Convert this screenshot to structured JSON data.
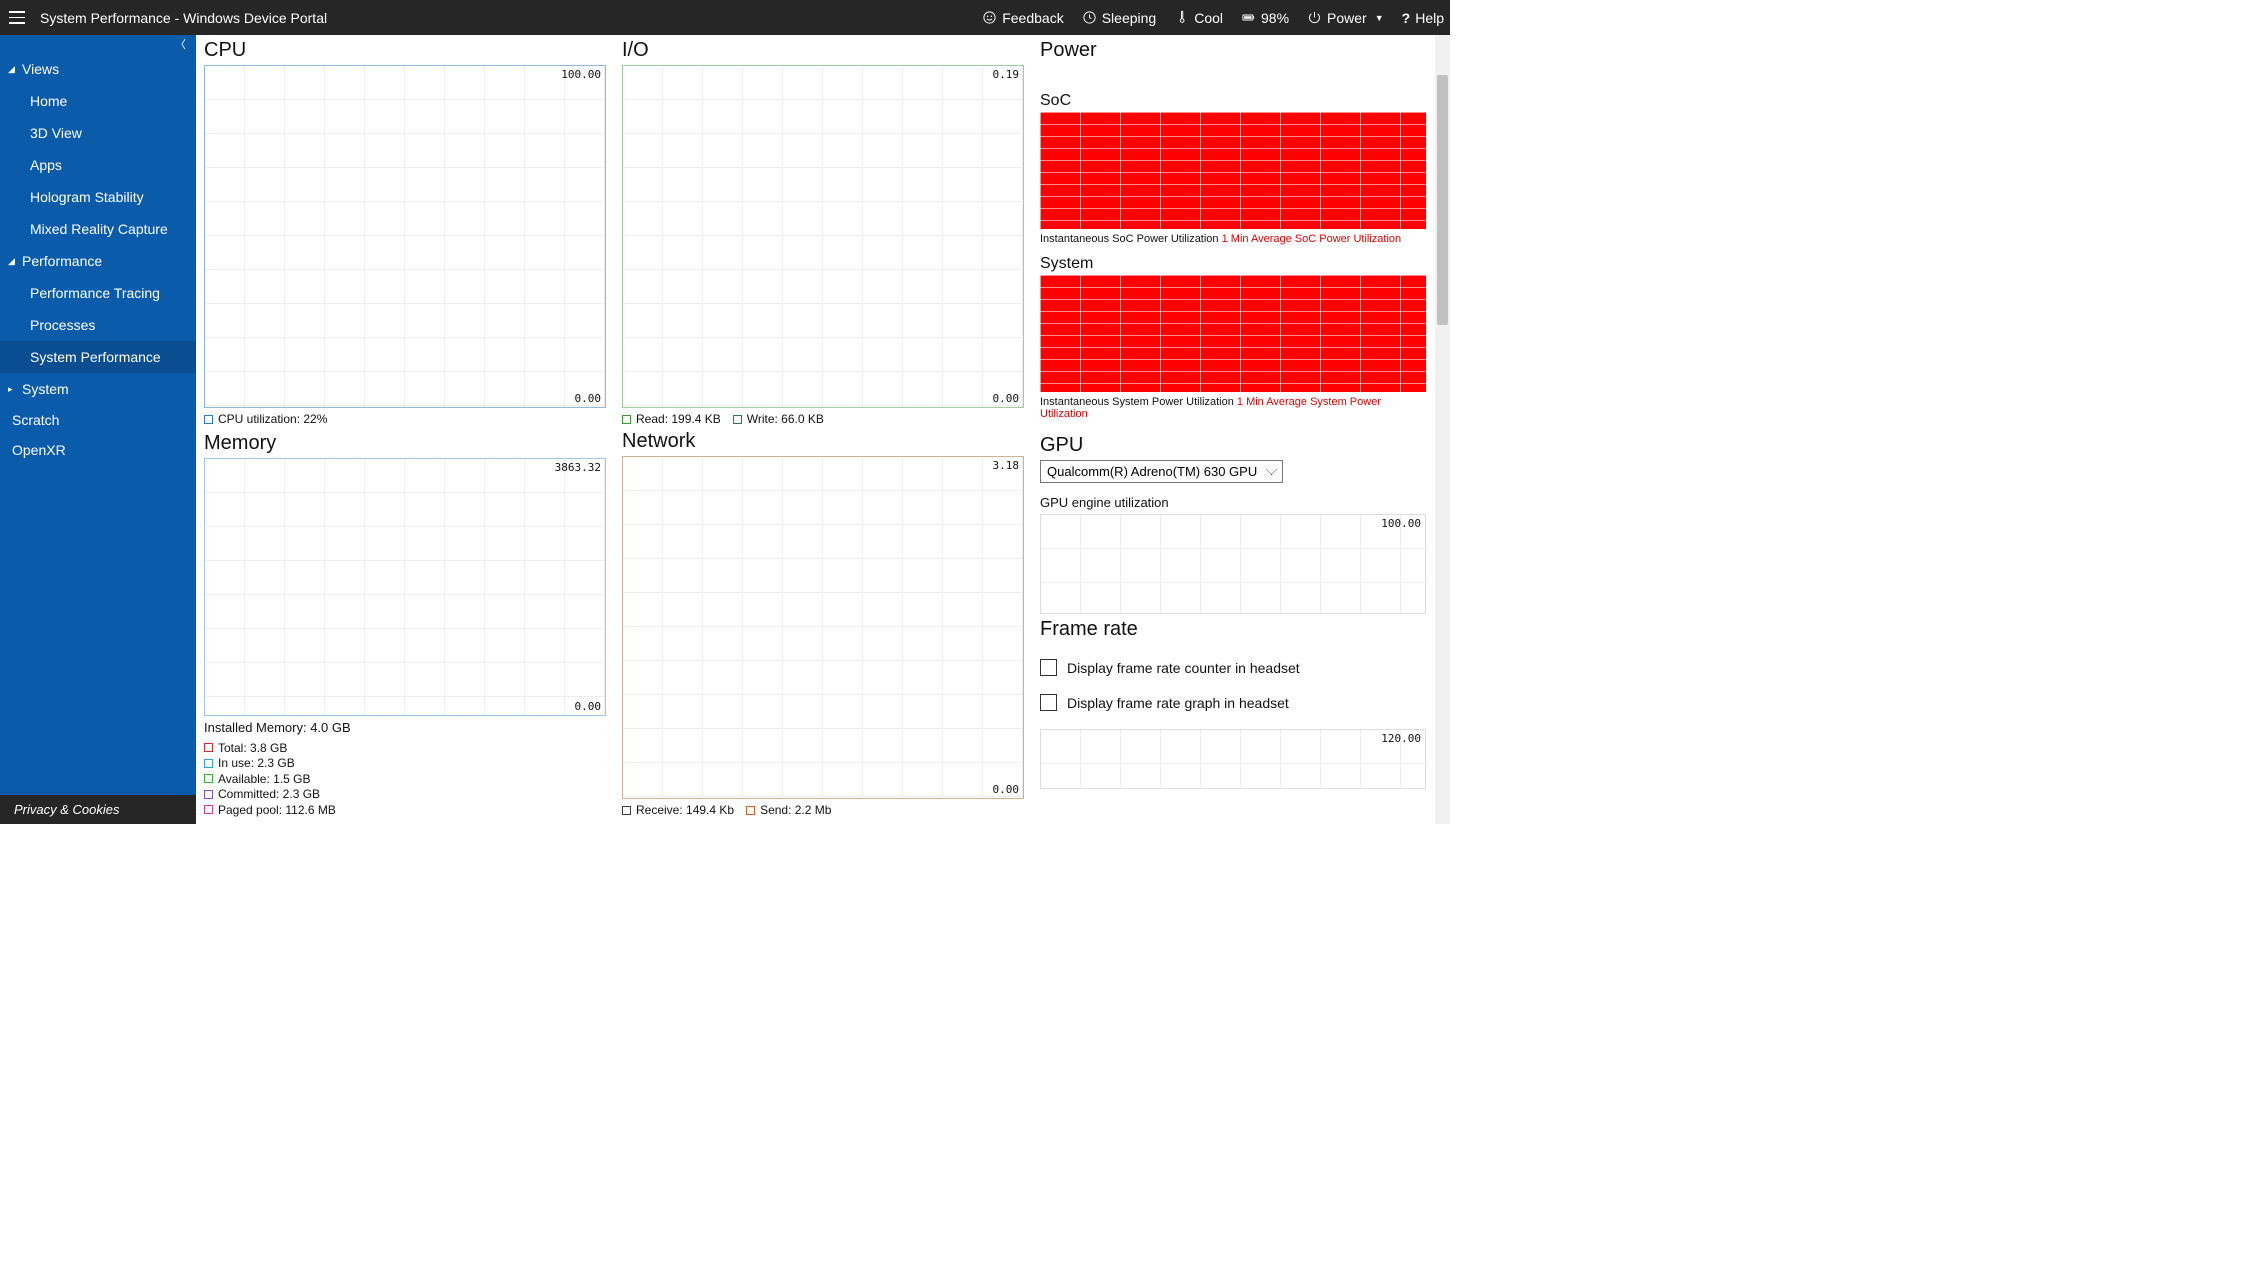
{
  "header": {
    "title": "System Performance - Windows Device Portal",
    "status": {
      "feedback": "Feedback",
      "sleeping": "Sleeping",
      "cool": "Cool",
      "battery": "98%",
      "power": "Power",
      "help": "Help"
    }
  },
  "sidebar": {
    "groups": [
      {
        "label": "Views",
        "expanded": true,
        "items": [
          "Home",
          "3D View",
          "Apps",
          "Hologram Stability",
          "Mixed Reality Capture"
        ]
      },
      {
        "label": "Performance",
        "expanded": true,
        "items": [
          "Performance Tracing",
          "Processes",
          "System Performance"
        ],
        "active_index": 2
      },
      {
        "label": "System",
        "expanded": false,
        "items": []
      }
    ],
    "flat": [
      "Scratch",
      "OpenXR"
    ],
    "footer": "Privacy & Cookies"
  },
  "panels": {
    "cpu": {
      "title": "CPU",
      "ymax": "100.00",
      "ymin": "0.00",
      "legend": "CPU utilization: 22%",
      "legend_color": "#2b7cd3"
    },
    "io": {
      "title": "I/O",
      "ymax": "0.19",
      "ymin": "0.00",
      "read_label": "Read: 199.4 KB",
      "write_label": "Write: 66.0 KB",
      "read_color": "#3a9a3a",
      "write_color": "#27736f"
    },
    "memory": {
      "title": "Memory",
      "ymax": "3863.32",
      "ymin": "0.00",
      "installed": "Installed Memory: 4.0 GB",
      "legend": [
        {
          "label": "Total: 3.8 GB",
          "color": "#d9232e"
        },
        {
          "label": "In use: 2.3 GB",
          "color": "#2aa7d6"
        },
        {
          "label": "Available: 1.5 GB",
          "color": "#2fb52f"
        },
        {
          "label": "Committed: 2.3 GB",
          "color": "#7b4fd6"
        },
        {
          "label": "Paged pool: 112.6 MB",
          "color": "#e23a8f"
        }
      ]
    },
    "network": {
      "title": "Network",
      "ymax": "3.18",
      "ymin": "0.00",
      "recv_label": "Receive: 149.4 Kb",
      "send_label": "Send: 2.2 Mb",
      "recv_color": "#3a3a3a",
      "send_color": "#d85a2a"
    },
    "power": {
      "title": "Power",
      "soc": {
        "title": "SoC",
        "inst": "Instantaneous SoC Power Utilization",
        "avg": "1 Min Average SoC Power Utilization"
      },
      "system": {
        "title": "System",
        "inst": "Instantaneous System Power Utilization",
        "avg": "1 Min Average System Power Utilization"
      }
    },
    "gpu": {
      "title": "GPU",
      "selected": "Qualcomm(R) Adreno(TM) 630 GPU",
      "engine_label": "GPU engine utilization",
      "ymax": "100.00"
    },
    "framerate": {
      "title": "Frame rate",
      "check1": "Display frame rate counter in headset",
      "check2": "Display frame rate graph in headset",
      "ymax": "120.00"
    }
  },
  "chart_data": [
    {
      "type": "line",
      "title": "CPU utilization",
      "ylim": [
        0,
        100
      ],
      "series": [
        {
          "name": "CPU utilization",
          "current": 22,
          "values": []
        }
      ]
    },
    {
      "type": "line",
      "title": "I/O",
      "ylim": [
        0,
        0.19
      ],
      "series": [
        {
          "name": "Read",
          "current_kb": 199.4,
          "values": []
        },
        {
          "name": "Write",
          "current_kb": 66.0,
          "values": []
        }
      ]
    },
    {
      "type": "line",
      "title": "Memory",
      "ylim": [
        0,
        3863.32
      ],
      "series": [
        {
          "name": "Total",
          "current_gb": 3.8
        },
        {
          "name": "In use",
          "current_gb": 2.3
        },
        {
          "name": "Available",
          "current_gb": 1.5
        },
        {
          "name": "Committed",
          "current_gb": 2.3
        },
        {
          "name": "Paged pool",
          "current_mb": 112.6
        }
      ],
      "installed_gb": 4.0
    },
    {
      "type": "line",
      "title": "Network",
      "ylim": [
        0,
        3.18
      ],
      "series": [
        {
          "name": "Receive",
          "current_kb": 149.4
        },
        {
          "name": "Send",
          "current_mb": 2.2
        }
      ]
    },
    {
      "type": "area",
      "title": "SoC Power Utilization",
      "ylim": [
        0,
        100
      ],
      "series": [
        {
          "name": "Instantaneous",
          "values_pct_fill": 100
        },
        {
          "name": "1 Min Average",
          "values_pct_fill": 100
        }
      ]
    },
    {
      "type": "area",
      "title": "System Power Utilization",
      "ylim": [
        0,
        100
      ],
      "series": [
        {
          "name": "Instantaneous",
          "values_pct_fill": 100
        },
        {
          "name": "1 Min Average",
          "values_pct_fill": 100
        }
      ]
    },
    {
      "type": "line",
      "title": "GPU engine utilization",
      "ylim": [
        0,
        100
      ],
      "series": []
    },
    {
      "type": "line",
      "title": "Frame rate",
      "ylim": [
        0,
        120
      ],
      "series": []
    }
  ]
}
